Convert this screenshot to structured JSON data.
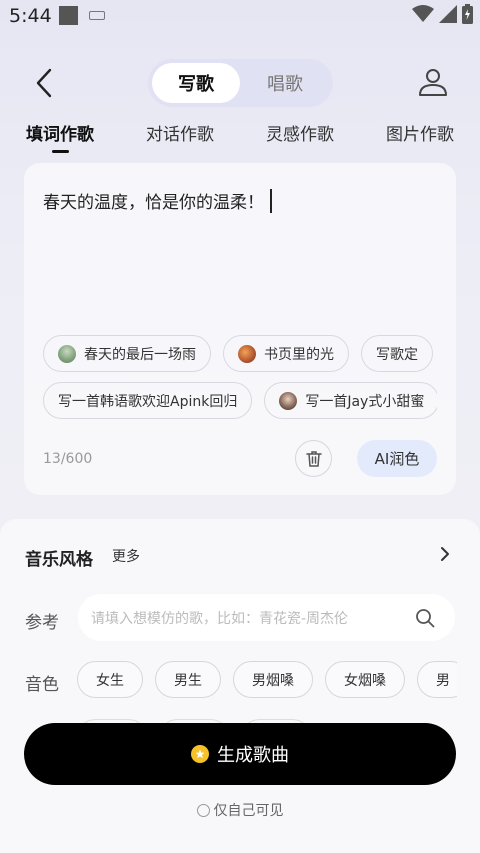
{
  "status_bar": {
    "time": "5:44"
  },
  "header": {
    "segments": [
      "写歌",
      "唱歌"
    ],
    "active_segment": "写歌"
  },
  "tabs": [
    "填词作歌",
    "对话作歌",
    "灵感作歌",
    "图片作歌"
  ],
  "editor": {
    "text": "春天的温度，恰是你的温柔！",
    "chips_row1": [
      "春天的最后一场雨",
      "书页里的光",
      "写歌定"
    ],
    "chips_row2": [
      "写一首韩语歌欢迎Apink回归",
      "写一首Jay式小甜蜜"
    ],
    "char_count": "13/600",
    "ai_polish_label": "AI润色"
  },
  "panel": {
    "style_label": "音乐风格",
    "more_label": "更多",
    "reference_label": "参考",
    "reference_placeholder": "请填入想模仿的歌，比如：青花瓷-周杰伦",
    "tone_label": "音色",
    "tones": [
      "女生",
      "男生",
      "男烟嗓",
      "女烟嗓",
      "男"
    ],
    "generate_label": "生成歌曲",
    "private_label": "仅自己可见"
  },
  "colors": {
    "accent_blue": "#e3eafb",
    "segment_bg": "#e1e1f4",
    "coin": "#f5c22a"
  }
}
